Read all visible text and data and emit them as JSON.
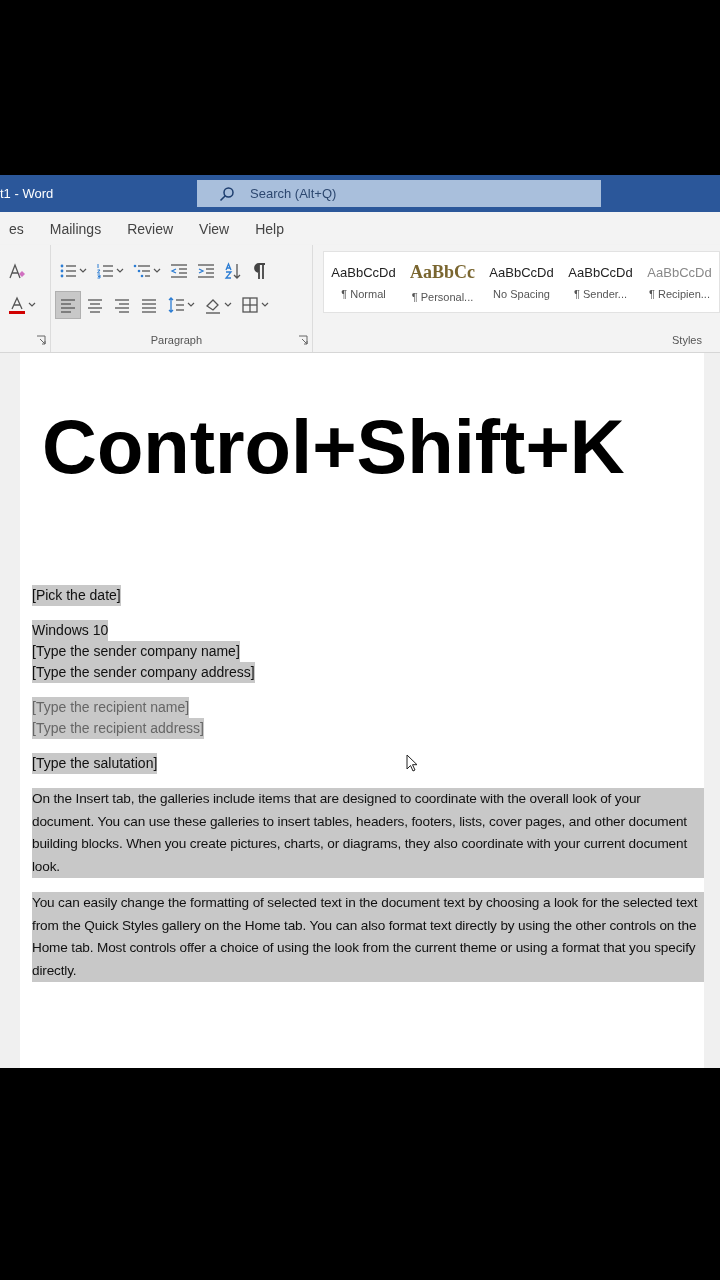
{
  "window": {
    "title": "t1 - Word"
  },
  "search": {
    "placeholder": "Search (Alt+Q)"
  },
  "tabs": [
    {
      "label": "es",
      "selected": false
    },
    {
      "label": "Mailings",
      "selected": false
    },
    {
      "label": "Review",
      "selected": false
    },
    {
      "label": "View",
      "selected": false
    },
    {
      "label": "Help",
      "selected": false
    }
  ],
  "ribbon": {
    "font_group": {
      "tools": [
        {
          "kind": "clear-format"
        },
        {
          "kind": "font-color"
        }
      ]
    },
    "paragraph_group": {
      "label": "Paragraph",
      "row_1": [
        {
          "kind": "bullets",
          "selected": false
        },
        {
          "kind": "numbering",
          "selected": false
        },
        {
          "kind": "multilevel",
          "selected": false
        },
        {
          "kind": "outdent",
          "selected": false
        },
        {
          "kind": "indent",
          "selected": false
        },
        {
          "kind": "sort",
          "selected": false
        },
        {
          "kind": "pilcrow",
          "selected": false
        }
      ],
      "row_2": [
        {
          "kind": "align-left",
          "selected": true
        },
        {
          "kind": "align-center",
          "selected": false
        },
        {
          "kind": "align-right",
          "selected": false
        },
        {
          "kind": "justify",
          "selected": false
        },
        {
          "kind": "line-spacing",
          "selected": false
        },
        {
          "kind": "shading",
          "selected": false
        },
        {
          "kind": "borders",
          "selected": false
        }
      ]
    },
    "styles_group": {
      "label": "Styles",
      "items": [
        {
          "sample": "AaBbCcDd",
          "name": "¶ Normal",
          "kind": "sans"
        },
        {
          "sample": "AaBbCc",
          "name": "¶ Personal...",
          "kind": "serif"
        },
        {
          "sample": "AaBbCcDd",
          "name": "No Spacing",
          "kind": "sans"
        },
        {
          "sample": "AaBbCcDd",
          "name": "¶ Sender...",
          "kind": "sans"
        },
        {
          "sample": "AaBbCcDd",
          "name": "¶ Recipien...",
          "kind": "light"
        }
      ]
    }
  },
  "caption": "Control+Shift+K",
  "document": {
    "groups": [
      {
        "blocks": [
          {
            "kind": "line",
            "text": "[Pick the date]",
            "selected": true,
            "placeholder": false
          }
        ]
      },
      {
        "blocks": [
          {
            "kind": "line",
            "text": "Windows 10",
            "selected": true,
            "placeholder": false
          },
          {
            "kind": "line",
            "text": "[Type the sender company name]",
            "selected": true,
            "placeholder": false
          },
          {
            "kind": "line",
            "text": "[Type the sender company address]",
            "selected": true,
            "placeholder": false
          }
        ]
      },
      {
        "blocks": [
          {
            "kind": "line",
            "text": "[Type the recipient name]",
            "selected": true,
            "placeholder": true
          },
          {
            "kind": "line",
            "text": "[Type the recipient address]",
            "selected": true,
            "placeholder": true
          }
        ]
      },
      {
        "blocks": [
          {
            "kind": "line",
            "text": "[Type the salutation]",
            "selected": true,
            "placeholder": false
          }
        ]
      },
      {
        "blocks": [
          {
            "kind": "paragraph",
            "text": "On the Insert tab, the galleries include items that are designed to coordinate with the overall look of your document. You can use these galleries to insert tables, headers, footers, lists, cover pages, and other document building blocks. When you create pictures, charts, or diagrams, they also coordinate with your current document look.",
            "selected": true,
            "placeholder": false
          }
        ]
      },
      {
        "blocks": [
          {
            "kind": "paragraph",
            "text": "You can easily change the formatting of selected text in the document text by choosing a look for the selected text from the Quick Styles gallery on the Home tab. You can also format text directly by using the other controls on the Home tab. Most controls offer a choice of using the look from the current theme or using a format that you specify directly.",
            "selected": true,
            "placeholder": false
          }
        ]
      }
    ]
  }
}
